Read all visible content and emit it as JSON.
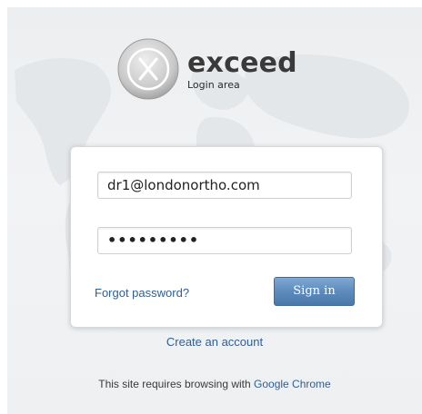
{
  "brand": {
    "name": "exceed",
    "subtitle": "Login area",
    "logo_icon": "x-circle-icon"
  },
  "login": {
    "email_value": "dr1@londonortho.com",
    "password_masked": "•••••••••",
    "forgot_label": "Forgot password?",
    "signin_label": "Sign in"
  },
  "footer": {
    "create_account_label": "Create an account",
    "requires_text": "This site requires browsing with",
    "chrome_link": "Google Chrome"
  },
  "colors": {
    "link": "#2e5f95",
    "button": "#5d8bbd",
    "background": "#eef0f2"
  }
}
